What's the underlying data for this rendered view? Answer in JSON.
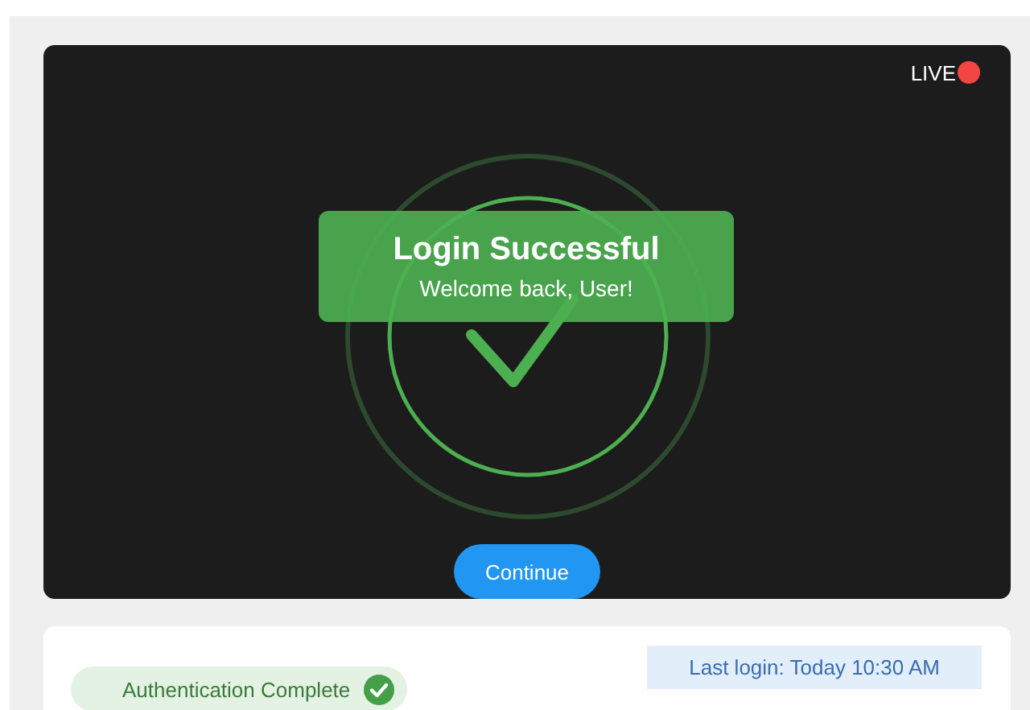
{
  "viewer": {
    "live_label": "LIVE",
    "banner": {
      "title": "Login Successful",
      "subtitle": "Welcome back, User!"
    },
    "button": "Continue"
  },
  "footer": {
    "status": "Authentication Complete",
    "last_login": "Last login: Today 10:30 AM"
  }
}
